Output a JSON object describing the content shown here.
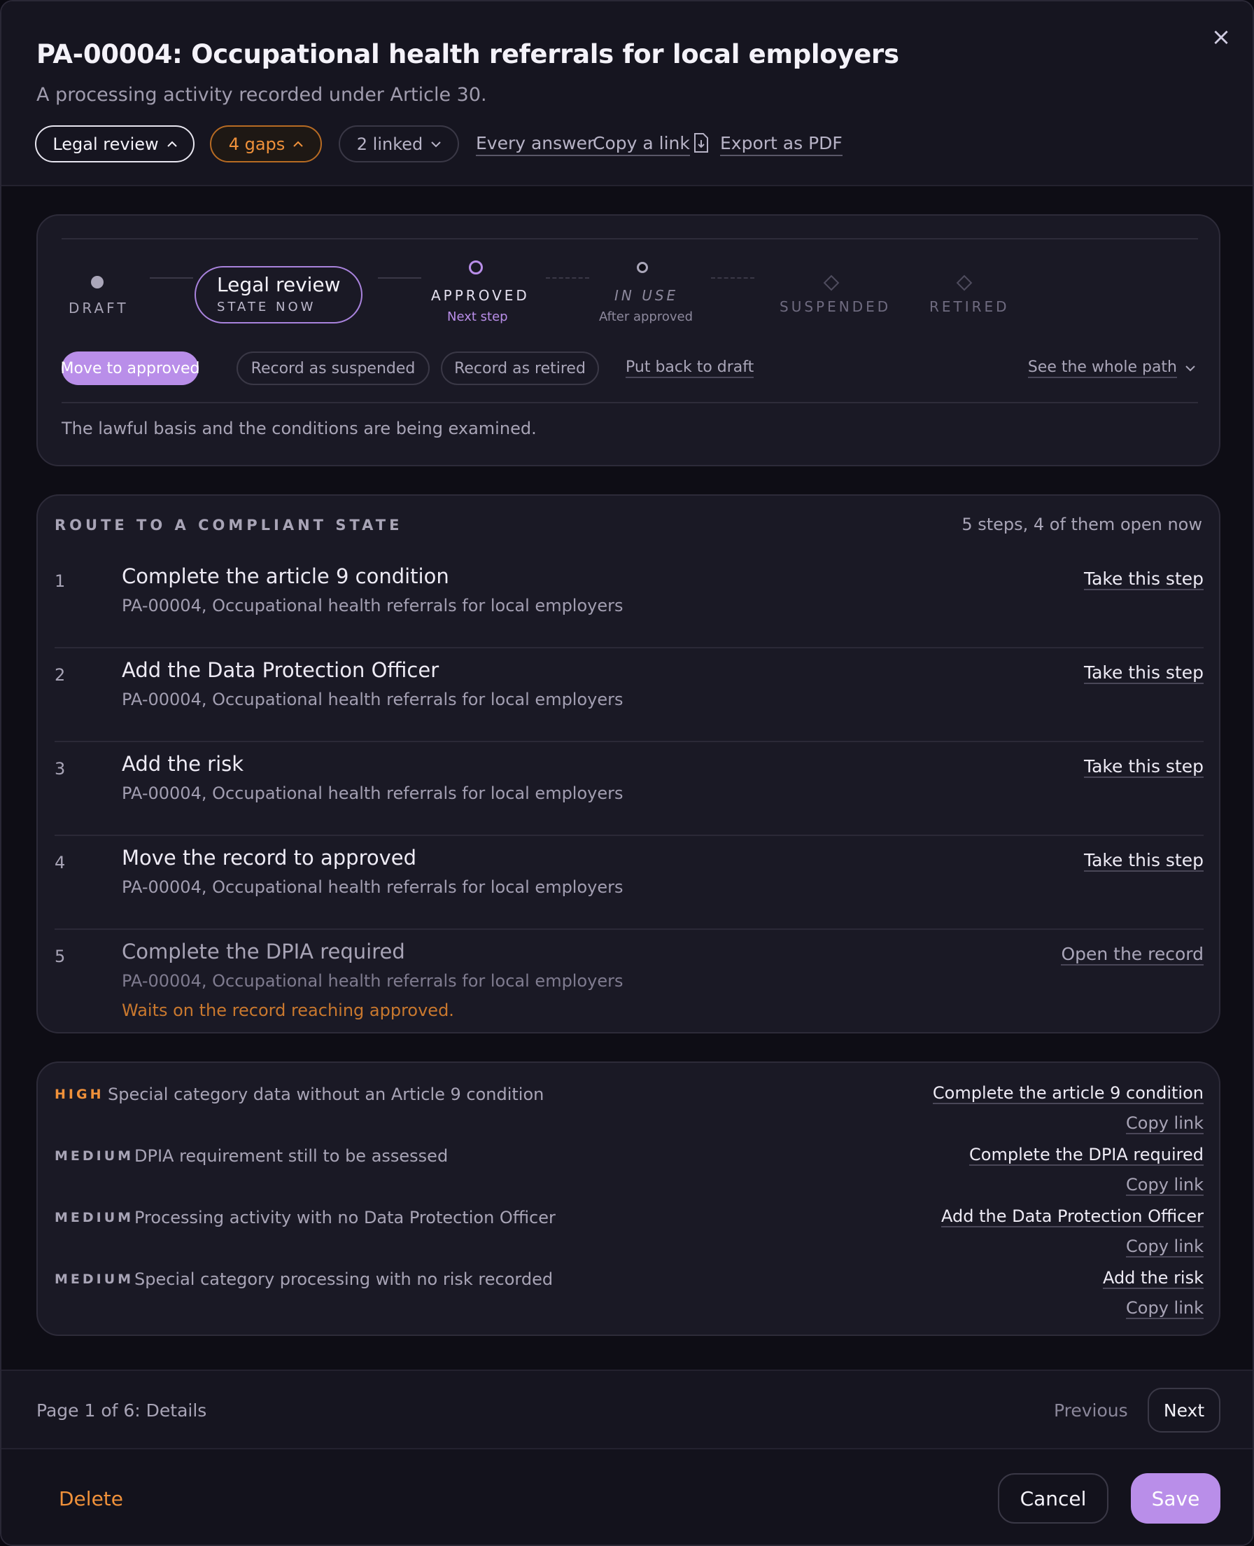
{
  "header": {
    "title": "PA-00004: Occupational health referrals for local employers",
    "subtitle": "A processing activity recorded under Article 30.",
    "close_icon": "×",
    "state_chip": "Legal review",
    "gaps_chip": "4 gaps",
    "linked_chip": "2 linked",
    "links": [
      "Every answer",
      "Copy a link",
      "Export as PDF"
    ],
    "chevron_up": "⌃",
    "chevron_down": "⌄"
  },
  "lifecycle": {
    "steps": [
      {
        "label": "DRAFT"
      },
      {
        "label": "Legal review",
        "sub": "STATE NOW"
      },
      {
        "label": "APPROVED",
        "sub": "Next step"
      },
      {
        "label": "IN USE",
        "sub": "After approved"
      },
      {
        "label": "SUSPENDED"
      },
      {
        "label": "RETIRED"
      }
    ],
    "actions": {
      "primary": "Move to approved",
      "suspend": "Record as suspended",
      "retire": "Record as retired",
      "draft": "Put back to draft",
      "path": "See the whole path"
    },
    "note": "The lawful basis and the conditions are being examined."
  },
  "route": {
    "title": "ROUTE TO A COMPLIANT STATE",
    "meta": "5 steps, 4 of them open now",
    "items": [
      {
        "num": "1",
        "title": "Complete the article 9 condition",
        "sub": "PA-00004, Occupational health referrals for local employers",
        "action": "Take this step"
      },
      {
        "num": "2",
        "title": "Add the Data Protection Officer",
        "sub": "PA-00004, Occupational health referrals for local employers",
        "action": "Take this step"
      },
      {
        "num": "3",
        "title": "Add the risk",
        "sub": "PA-00004, Occupational health referrals for local employers",
        "action": "Take this step"
      },
      {
        "num": "4",
        "title": "Move the record to approved",
        "sub": "PA-00004, Occupational health referrals for local employers",
        "action": "Take this step"
      },
      {
        "num": "5",
        "title": "Complete the DPIA required",
        "sub": "PA-00004, Occupational health referrals for local employers",
        "action": "Open the record",
        "warning": "Waits on the record reaching approved."
      }
    ]
  },
  "gaps": [
    {
      "severity": "HIGH",
      "text": "Special category data without an Article 9 condition",
      "action": "Complete the article 9 condition",
      "copy": "Copy link"
    },
    {
      "severity": "MEDIUM",
      "text": "DPIA requirement still to be assessed",
      "action": "Complete the DPIA required",
      "copy": "Copy link"
    },
    {
      "severity": "MEDIUM",
      "text": "Processing activity with no Data Protection Officer",
      "action": "Add the Data Protection Officer",
      "copy": "Copy link"
    },
    {
      "severity": "MEDIUM",
      "text": "Special category processing with no risk recorded",
      "action": "Add the risk",
      "copy": "Copy link"
    }
  ],
  "pager": {
    "info": "Page 1 of 6: Details",
    "previous": "Previous",
    "next": "Next"
  },
  "footer": {
    "delete": "Delete",
    "cancel": "Cancel",
    "save": "Save"
  },
  "colors": {
    "accent": "#b98ee9",
    "warning": "#f0913a",
    "background": "#0e0d15",
    "card": "#1a1925"
  }
}
